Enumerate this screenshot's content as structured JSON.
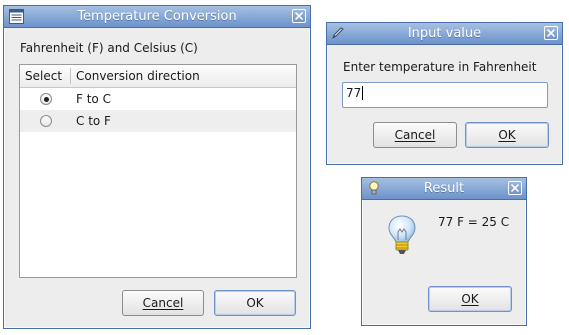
{
  "temp_window": {
    "title": "Temperature Conversion",
    "heading": "Fahrenheit (F) and Celsius (C)",
    "columns": [
      "Select",
      "Conversion direction"
    ],
    "rows": [
      {
        "label": "F to C",
        "selected": true
      },
      {
        "label": "C to F",
        "selected": false
      }
    ],
    "cancel_label": "Cancel",
    "ok_label": "OK"
  },
  "input_window": {
    "title": "Input value",
    "prompt": "Enter temperature in Fahrenheit",
    "value": "77",
    "cancel_label": "Cancel",
    "ok_label": "OK"
  },
  "result_window": {
    "title": "Result",
    "message": "77 F = 25 C",
    "ok_label": "OK"
  },
  "icons": {
    "window_icon": "list-window-icon",
    "input_icon": "pen-icon",
    "result_icon": "lightbulb-icon",
    "close": "close-icon"
  },
  "colors": {
    "titlebar": "#6c93cb",
    "window_bg": "#ededed",
    "row_alt": "#eeeeee"
  }
}
